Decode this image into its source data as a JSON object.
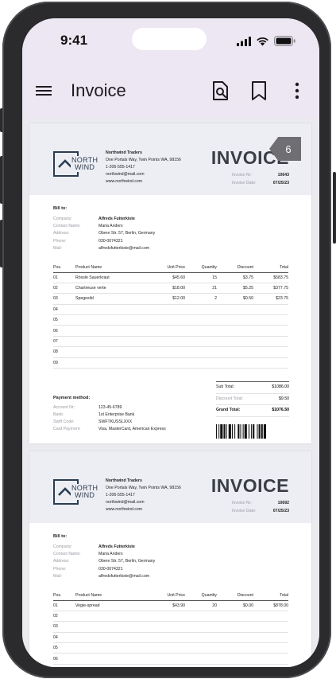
{
  "status_bar": {
    "time": "9:41"
  },
  "app_bar": {
    "title": "Invoice"
  },
  "page_badge": "6",
  "pages": [
    {
      "logo": {
        "line1": "NORTH",
        "line2": "WIND"
      },
      "company": {
        "name": "Northwind Traders",
        "address": "One Portals Way, Twin Points WA, 98156",
        "phone": "1-206-555-1417",
        "email": "northwind@mail.com",
        "web": "www.northwind.com"
      },
      "title": "INVOICE",
      "meta": [
        {
          "k": "Invoice Nr:",
          "v": "10643"
        },
        {
          "k": "Invoice Date:",
          "v": "07/25/23"
        }
      ],
      "bill_to_heading": "Bill to:",
      "bill_to": [
        {
          "k": "Company:",
          "v": "Alfreds Futterkiste"
        },
        {
          "k": "Contact Name:",
          "v": "Maria Anders"
        },
        {
          "k": "Address:",
          "v": "Obere Str. 57, Berlin, Germany"
        },
        {
          "k": "Phone:",
          "v": "030-0074321"
        },
        {
          "k": "Mail:",
          "v": "alfredsfutterkiste@mail.com"
        }
      ],
      "columns": [
        "Pos.",
        "Product Name",
        "Unit Price",
        "Quantity",
        "Discount",
        "Total"
      ],
      "rows": [
        [
          "01",
          "Rössle Sauerkraut",
          "$45.60",
          "15",
          "$3.75",
          "$583.75"
        ],
        [
          "02",
          "Chartreuse verte",
          "$18.00",
          "21",
          "$5.25",
          "$377.75"
        ],
        [
          "03",
          "Spegesild",
          "$12.00",
          "2",
          "$0.50",
          "$23.75"
        ],
        [
          "04",
          "",
          "",
          "",
          "",
          ""
        ],
        [
          "05",
          "",
          "",
          "",
          "",
          ""
        ],
        [
          "06",
          "",
          "",
          "",
          "",
          ""
        ],
        [
          "07",
          "",
          "",
          "",
          "",
          ""
        ],
        [
          "08",
          "",
          "",
          "",
          "",
          ""
        ],
        [
          "09",
          "",
          "",
          "",
          "",
          ""
        ]
      ],
      "totals": [
        {
          "k": "Sub Total:",
          "v": "$1086.00"
        },
        {
          "k": "Discount Total:",
          "v": "$9.50"
        },
        {
          "k": "Grand Total:",
          "v": "$1076.50"
        }
      ],
      "payment_heading": "Payment method:",
      "payment": [
        {
          "k": "Account Nr:",
          "v": "123-45-6789"
        },
        {
          "k": "Bank:",
          "v": "1st Enterprise Bank"
        },
        {
          "k": "Swift Code:",
          "v": "SWFTKUSSLXXX"
        },
        {
          "k": "Card Payment:",
          "v": "Visa, MasterCard, American Express"
        }
      ]
    },
    {
      "logo": {
        "line1": "NORTH",
        "line2": "WIND"
      },
      "company": {
        "name": "Northwind Traders",
        "address": "One Portals Way, Twin Points WA, 98156",
        "phone": "1-206-555-1417",
        "email": "northwind@mail.com",
        "web": "www.northwind.com"
      },
      "title": "INVOICE",
      "meta": [
        {
          "k": "Invoice Nr:",
          "v": "10692"
        },
        {
          "k": "Invoice Date:",
          "v": "07/25/23"
        }
      ],
      "bill_to_heading": "Bill to:",
      "bill_to": [
        {
          "k": "Company:",
          "v": "Alfreds Futterkiste"
        },
        {
          "k": "Contact Name:",
          "v": "Maria Anders"
        },
        {
          "k": "Address:",
          "v": "Obere Str. 57, Berlin, Germany"
        },
        {
          "k": "Phone:",
          "v": "030-0074321"
        },
        {
          "k": "Mail:",
          "v": "alfredsfutterkiste@mail.com"
        }
      ],
      "columns": [
        "Pos.",
        "Product Name",
        "Unit Price",
        "Quantity",
        "Discount",
        "Total"
      ],
      "rows": [
        [
          "01",
          "Vegie-spread",
          "$43.90",
          "20",
          "$0.00",
          "$878.00"
        ],
        [
          "02",
          "",
          "",
          "",
          "",
          ""
        ],
        [
          "03",
          "",
          "",
          "",
          "",
          ""
        ],
        [
          "04",
          "",
          "",
          "",
          "",
          ""
        ],
        [
          "05",
          "",
          "",
          "",
          "",
          ""
        ],
        [
          "06",
          "",
          "",
          "",
          "",
          ""
        ]
      ]
    }
  ]
}
